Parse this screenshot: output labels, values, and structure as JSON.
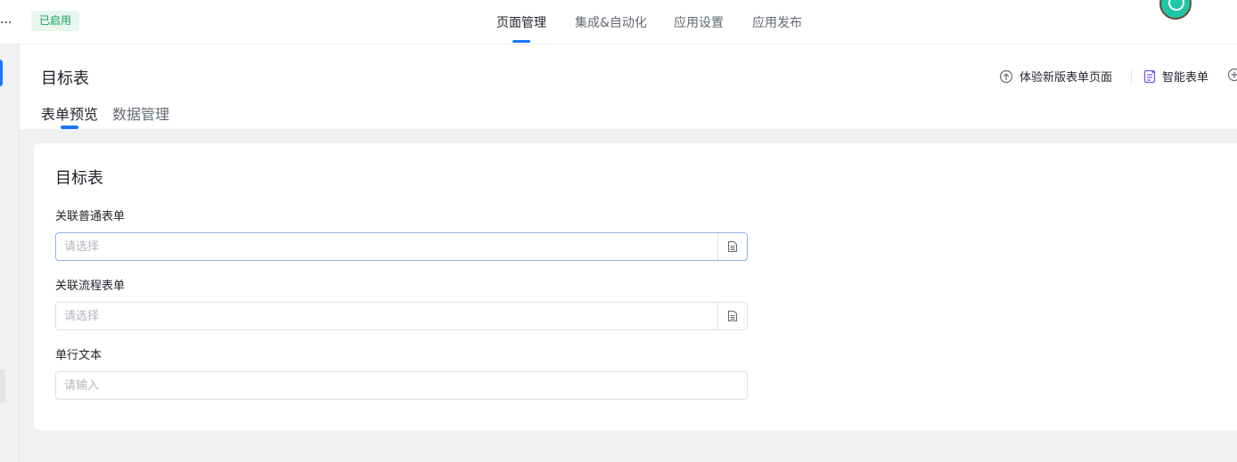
{
  "header": {
    "app_name": "...",
    "status_badge": "已启用",
    "tabs": [
      {
        "label": "页面管理",
        "active": true
      },
      {
        "label": "集成&自动化",
        "active": false
      },
      {
        "label": "应用设置",
        "active": false
      },
      {
        "label": "应用发布",
        "active": false
      }
    ]
  },
  "page": {
    "title": "目标表",
    "actions": {
      "new_form_page": "体验新版表单页面",
      "smart_form": "智能表单"
    },
    "subtabs": [
      {
        "label": "表单预览",
        "active": true
      },
      {
        "label": "数据管理",
        "active": false
      }
    ]
  },
  "form": {
    "title": "目标表",
    "fields": [
      {
        "label": "关联普通表单",
        "placeholder": "请选择",
        "type": "picker",
        "icon": "document-icon"
      },
      {
        "label": "关联流程表单",
        "placeholder": "请选择",
        "type": "picker",
        "icon": "document-icon"
      },
      {
        "label": "单行文本",
        "placeholder": "请输入",
        "type": "text"
      }
    ]
  },
  "colors": {
    "accent": "#1677ff",
    "status_green": "#15a35a",
    "status_bg": "#e7f6ee",
    "page_bg": "#f0f1f3",
    "smart_form_icon": "#6b5cf6"
  }
}
